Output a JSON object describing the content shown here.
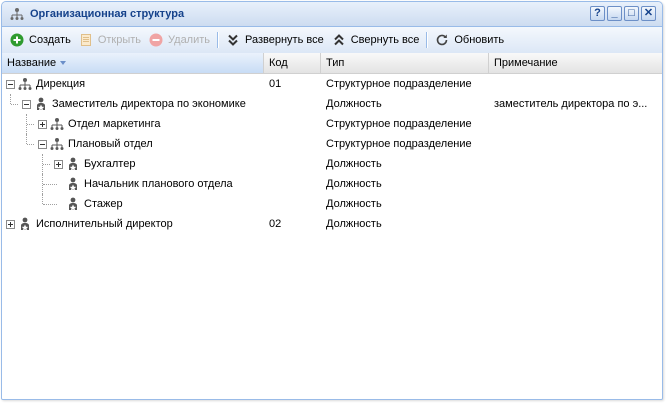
{
  "window": {
    "title": "Организационная структура",
    "tools": [
      "?",
      "_",
      "□",
      "✕"
    ]
  },
  "toolbar": {
    "create": "Создать",
    "open": "Открыть",
    "delete": "Удалить",
    "expand_all": "Развернуть все",
    "collapse_all": "Свернуть все",
    "refresh": "Обновить"
  },
  "columns": {
    "name": "Название",
    "code": "Код",
    "type": "Тип",
    "note": "Примечание"
  },
  "rows": [
    {
      "name": "Дирекция",
      "code": "01",
      "type": "Структурное подразделение",
      "note": "",
      "icon": "org-structure-icon",
      "expander": "minus"
    },
    {
      "name": "Заместитель директора по экономике",
      "code": "",
      "type": "Должность",
      "note": "заместитель директора по э...",
      "icon": "position-icon",
      "expander": "minus"
    },
    {
      "name": "Отдел маркетинга",
      "code": "",
      "type": "Структурное подразделение",
      "note": "",
      "icon": "org-structure-icon",
      "expander": "plus"
    },
    {
      "name": "Плановый отдел",
      "code": "",
      "type": "Структурное подразделение",
      "note": "",
      "icon": "org-structure-icon",
      "expander": "minus"
    },
    {
      "name": "Бухгалтер",
      "code": "",
      "type": "Должность",
      "note": "",
      "icon": "position-icon",
      "expander": "plus"
    },
    {
      "name": "Начальник планового отдела",
      "code": "",
      "type": "Должность",
      "note": "",
      "icon": "position-icon",
      "expander": "none"
    },
    {
      "name": "Стажер",
      "code": "",
      "type": "Должность",
      "note": "",
      "icon": "position-icon",
      "expander": "none"
    },
    {
      "name": "Исполнительный директор",
      "code": "02",
      "type": "Должность",
      "note": "",
      "icon": "position-icon",
      "expander": "plus"
    }
  ]
}
